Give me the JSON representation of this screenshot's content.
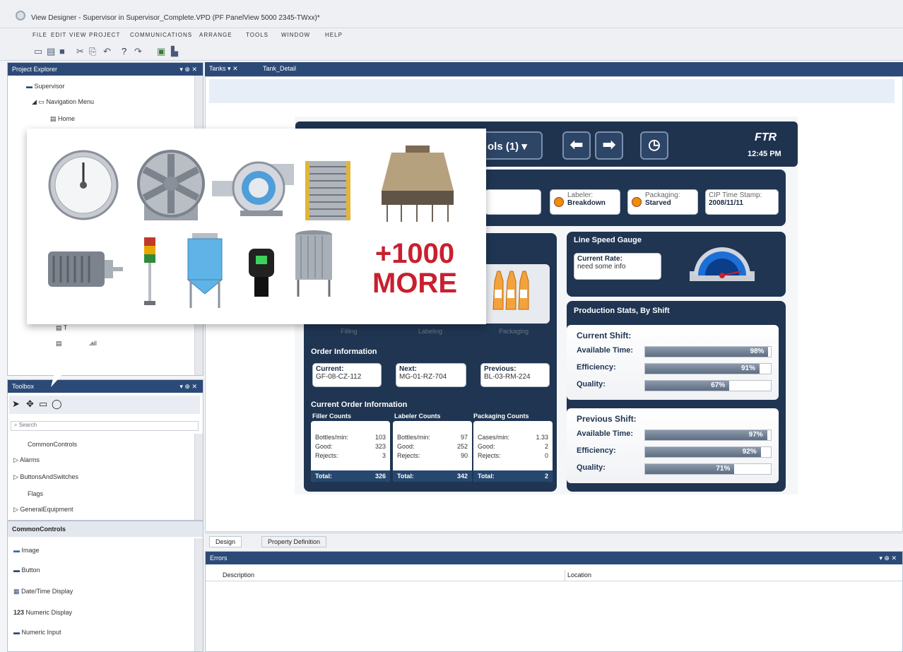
{
  "window": {
    "title": "View Designer - Supervisor in Supervisor_Complete.VPD (PF PanelView 5000 2345-TWxx)*"
  },
  "menu": [
    "FILE",
    "EDIT",
    "VIEW",
    "PROJECT",
    "COMMUNICATIONS",
    "ARRANGE",
    "TOOLS",
    "WINDOW",
    "HELP"
  ],
  "project_explorer": {
    "title": "Project Explorer",
    "controls": "▾ ⊕ ✕",
    "items": [
      "Supervisor",
      "Navigation Menu",
      "Home",
      "Tanks",
      "Tank_Detail"
    ]
  },
  "tabs": [
    "Tanks",
    "Tank_Detail"
  ],
  "toolbox": {
    "title": "Toolbox",
    "controls": "▾ ⊕ ✕",
    "search_placeholder": "Search",
    "items": [
      "CommonControls",
      "Alarms",
      "ButtonsAndSwitches",
      "Flags",
      "GeneralEquipment"
    ]
  },
  "common_controls": {
    "title": "CommonControls",
    "items": [
      "Image",
      "Button",
      "Date/Time Display",
      "Numeric Display",
      "Numeric Input"
    ]
  },
  "bottom_tabs": [
    "Design",
    "Property Definition"
  ],
  "errors": {
    "title": "Errors",
    "controls": "▾ ⊕ ✕",
    "columns": [
      "Description",
      "Location"
    ]
  },
  "hmi": {
    "header": {
      "dropdown": "ols (1) ▾",
      "time": "12:45 PM",
      "logo": "FTR"
    },
    "status": [
      {
        "label": "Labeler:",
        "value": "Breakdown"
      },
      {
        "label": "Packaging:",
        "value": "Starved"
      }
    ],
    "cip": {
      "label": "CIP Time Stamp:",
      "value": "2008/11/11"
    },
    "line_speed": {
      "title": "Line Speed Gauge",
      "rate_label": "Current Rate:",
      "rate_value": "need some info"
    },
    "stations": [
      "Filling",
      "Labeling",
      "Packaging"
    ],
    "order_info": {
      "title": "Order Information",
      "current_label": "Current:",
      "current": "GF-08-CZ-112",
      "next_label": "Next:",
      "next": "MG-01-RZ-704",
      "previous_label": "Previous:",
      "previous": "BL-03-RM-224"
    },
    "current_order": {
      "title": "Current Order Information",
      "groups": [
        {
          "title": "Filler Counts",
          "rows": [
            [
              "Bottles/min:",
              "103"
            ],
            [
              "Good:",
              "323"
            ],
            [
              "Rejects:",
              "3"
            ]
          ],
          "total": [
            "Total:",
            "326"
          ]
        },
        {
          "title": "Labeler Counts",
          "rows": [
            [
              "Bottles/min:",
              "97"
            ],
            [
              "Good:",
              "252"
            ],
            [
              "Rejects:",
              "90"
            ]
          ],
          "total": [
            "Total:",
            "342"
          ]
        },
        {
          "title": "Packaging Counts",
          "rows": [
            [
              "Cases/min:",
              "1.33"
            ],
            [
              "Good:",
              "2"
            ],
            [
              "Rejects:",
              "0"
            ]
          ],
          "total": [
            "Total:",
            "2"
          ]
        }
      ]
    },
    "production": {
      "title": "Production Stats, By Shift",
      "current": {
        "title": "Current Shift:",
        "stats": [
          {
            "label": "Available Time:",
            "value": 98,
            "text": "98%"
          },
          {
            "label": "Efficiency:",
            "value": 91,
            "text": "91%"
          },
          {
            "label": "Quality:",
            "value": 67,
            "text": "67%"
          }
        ]
      },
      "previous": {
        "title": "Previous Shift:",
        "stats": [
          {
            "label": "Available Time:",
            "value": 97,
            "text": "97%"
          },
          {
            "label": "Efficiency:",
            "value": 92,
            "text": "92%"
          },
          {
            "label": "Quality:",
            "value": 71,
            "text": "71%"
          }
        ]
      }
    }
  },
  "promo": {
    "line1": "+1000",
    "line2": "MORE"
  },
  "colors": {
    "accent": "#c8202f",
    "panel": "#1f3552"
  }
}
